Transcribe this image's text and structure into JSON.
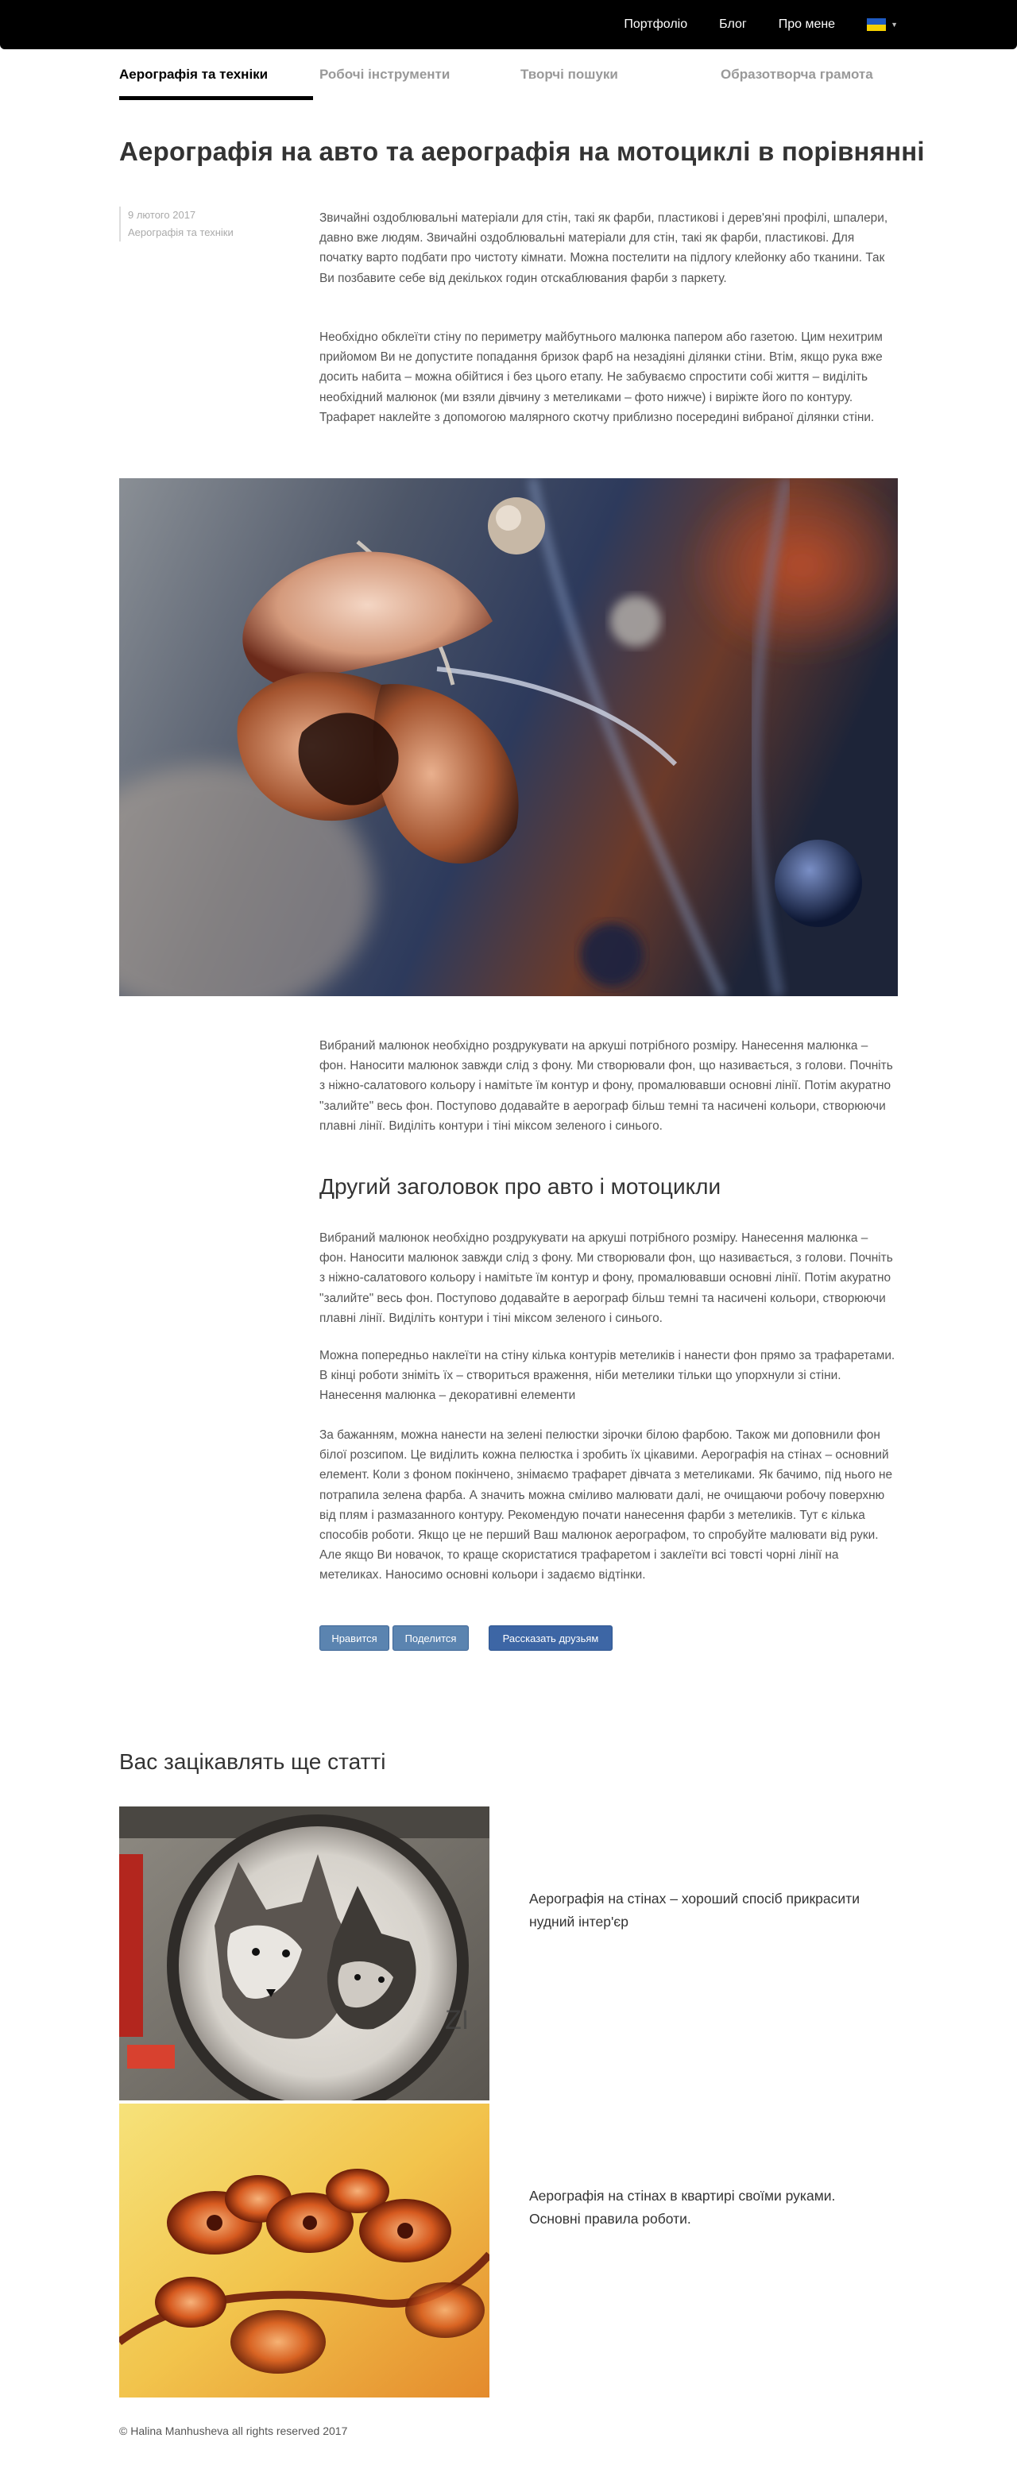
{
  "nav": {
    "items": [
      "Портфоліо",
      "Блог",
      "Про мене"
    ],
    "language_icon": "ukraine-flag-icon"
  },
  "tabs": [
    "Аерографія та техніки",
    "Робочі інструменти",
    "Творчі пошуки",
    "Образотворча грамота"
  ],
  "article": {
    "title": "Аерографія на авто та аерографія на мотоциклі в порівнянні",
    "date": "9 лютого 2017",
    "category": "Аерографія та техніки",
    "paragraph_1": "Звичайні оздоблювальні матеріали для стін, такі як фарби, пластикові і дерев'яні профілі, шпалери, давно вже людям. Звичайні оздоблювальні матеріали для стін, такі як фарби, пластикові. Для початку варто подбати про чистоту кімнати. Можна постелити на підлогу клейонку або тканини. Так Ви позбавите себе від декількох годин отскаблювания фарби з паркету.",
    "paragraph_2": "Необхідно обклеїти стіну по периметру майбутнього малюнка папером або газетою. Цим нехитрим прийомом Ви не допустите попадання бризок фарб на незадіяні ділянки стіни. Втім, якщо рука вже досить набита – можна обійтися і без цього етапу. Не забуваємо спростити собі життя – виділіть необхідний малюнок (ми взяли дівчину з метеликами – фото нижче) і виріжте його по контуру. Трафарет наклейте з допомогою малярного скотчу приблизно посередині вибраної ділянки стіни.",
    "paragraph_3": "Вибраний малюнок необхідно роздрукувати на аркуші потрібного розміру. Нанесення малюнка – фон. Наносити малюнок завжди слід з фону. Ми створювали фон, що називається, з голови. Почніть з ніжно-салатового кольору і намітьте їм контур и фону, промалювавши основні лінії. Потім акуратно \"залийте\" весь фон. Поступово додавайте в аерограф більш темні та насичені кольори, створюючи плавні лінії. Виділіть контури і тіні міксом зеленого і синього.",
    "subheading": "Другий заголовок про авто і мотоцикли",
    "paragraph_4": "Вибраний малюнок необхідно роздрукувати на аркуші потрібного розміру. Нанесення малюнка – фон. Наносити малюнок завжди слід з фону. Ми створювали фон, що називається, з голови. Почніть з ніжно-салатового кольору і намітьте їм контур и фону, промалювавши основні лінії. Потім акуратно \"залийте\" весь фон. Поступово додавайте в аерограф більш темні та насичені кольори, створюючи плавні лінії. Виділіть контури і тіні міксом зеленого і синього.",
    "paragraph_5": "Можна попередньо наклеїти на стіну кілька контурів метеликів і нанести фон прямо за трафаретами. В кінці роботи зніміть їх – створиться враження, ніби метелики тільки що упорхнули зі стіни. Нанесення малюнка – декоративні елементи",
    "paragraph_6": "За бажанням, можна нанести на зелені пелюстки зірочки білою фарбою. Також ми доповнили фон білої розсипом. Це виділить кожна пелюстка і зробить їх цікавими. Аерографія на стінах – основний елемент. Коли з фоном покінчено, знімаємо трафарет дівчата з метеликами. Як бачимо, під нього не потрапила зелена фарба. А значить можна сміливо малювати далі, не очищаючи робочу поверхню від плям і размазанного контуру. Рекомендую почати нанесення фарби з метеликів. Тут є кілька способів роботи. Якщо це не перший Ваш малюнок аерографом, то спробуйте малювати від руки. Але якщо Ви новачок, то краще скористатися трафаретом і заклеїти всі товсті чорні лінії на метеликах. Наносимо основні кольори і задаємо відтінки."
  },
  "social": {
    "like": "Нравится",
    "share": "Поделится",
    "tell_friends": "Рассказать друзьям"
  },
  "related": {
    "title": "Вас зацікавлять ще статті",
    "items": [
      "Аерографія на стінах – хороший спосіб прикрасити нудний інтер'єр",
      "Аерографія на стінах в квартирі своїми руками. Основні правила роботи."
    ]
  },
  "footer": "© Halina Manhusheva all rights reserved 2017"
}
